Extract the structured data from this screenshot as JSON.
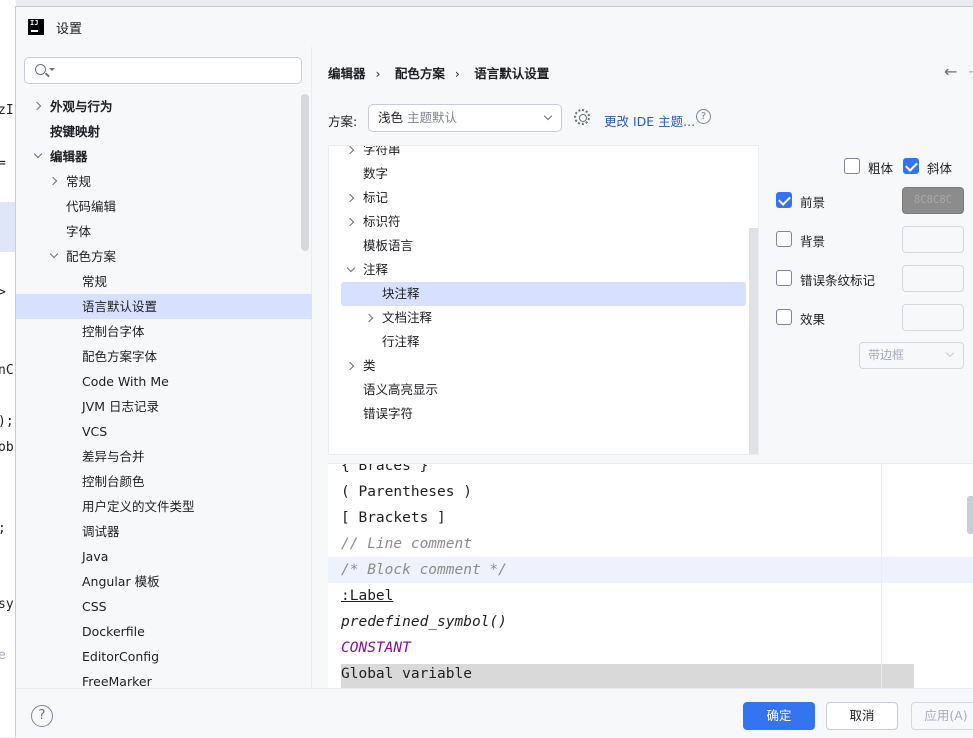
{
  "window": {
    "title": "设置"
  },
  "background_editor": {
    "fragments": [
      "zI",
      "=",
      ">",
      "nC",
      ");",
      "ob",
      ";",
      "sy",
      "e"
    ]
  },
  "search": {
    "placeholder": ""
  },
  "tree": [
    {
      "label": "外观与行为",
      "bold": true,
      "expand": "collapsed"
    },
    {
      "label": "按键映射",
      "bold": true,
      "expand": "none"
    },
    {
      "label": "编辑器",
      "bold": true,
      "expand": "expanded"
    },
    {
      "label": "常规",
      "bold": false,
      "expand": "collapsed"
    },
    {
      "label": "代码编辑",
      "bold": false,
      "expand": "none"
    },
    {
      "label": "字体",
      "bold": false,
      "expand": "none"
    },
    {
      "label": "配色方案",
      "bold": false,
      "expand": "expanded"
    },
    {
      "label": "常规",
      "bold": false,
      "expand": "none"
    },
    {
      "label": "语言默认设置",
      "bold": false,
      "expand": "none",
      "selected": true
    },
    {
      "label": "控制台字体",
      "bold": false,
      "expand": "none"
    },
    {
      "label": "配色方案字体",
      "bold": false,
      "expand": "none"
    },
    {
      "label": "Code With Me",
      "bold": false,
      "expand": "none"
    },
    {
      "label": "JVM 日志记录",
      "bold": false,
      "expand": "none"
    },
    {
      "label": "VCS",
      "bold": false,
      "expand": "none"
    },
    {
      "label": "差异与合并",
      "bold": false,
      "expand": "none"
    },
    {
      "label": "控制台颜色",
      "bold": false,
      "expand": "none"
    },
    {
      "label": "用户定义的文件类型",
      "bold": false,
      "expand": "none"
    },
    {
      "label": "调试器",
      "bold": false,
      "expand": "none"
    },
    {
      "label": "Java",
      "bold": false,
      "expand": "none"
    },
    {
      "label": "Angular 模板",
      "bold": false,
      "expand": "none"
    },
    {
      "label": "CSS",
      "bold": false,
      "expand": "none"
    },
    {
      "label": "Dockerfile",
      "bold": false,
      "expand": "none"
    },
    {
      "label": "EditorConfig",
      "bold": false,
      "expand": "none"
    },
    {
      "label": "FreeMarker",
      "bold": false,
      "expand": "none"
    }
  ],
  "breadcrumb": [
    "编辑器",
    "配色方案",
    "语言默认设置"
  ],
  "nav": {
    "back": "←",
    "forward": "→"
  },
  "scheme": {
    "label": "方案:",
    "value": "浅色",
    "hint": "主题默认",
    "link": "更改 IDE 主题...",
    "help": "?"
  },
  "attributes": [
    {
      "label": "字符串",
      "expand": "collapsed"
    },
    {
      "label": "数字",
      "expand": "none"
    },
    {
      "label": "标记",
      "expand": "collapsed"
    },
    {
      "label": "标识符",
      "expand": "collapsed"
    },
    {
      "label": "模板语言",
      "expand": "none"
    },
    {
      "label": "注释",
      "expand": "expanded"
    },
    {
      "label": "块注释",
      "expand": "none",
      "child": true,
      "selected": true
    },
    {
      "label": "文档注释",
      "expand": "collapsed",
      "child": true
    },
    {
      "label": "行注释",
      "expand": "none",
      "child": true
    },
    {
      "label": "类",
      "expand": "collapsed"
    },
    {
      "label": "语义高亮显示",
      "expand": "none"
    },
    {
      "label": "错误字符",
      "expand": "none"
    }
  ],
  "props": {
    "bold": {
      "label": "粗体",
      "checked": false
    },
    "italic": {
      "label": "斜体",
      "checked": true
    },
    "foreground": {
      "label": "前景",
      "checked": true,
      "color": "8C8C8C"
    },
    "background": {
      "label": "背景",
      "checked": false
    },
    "error_stripe": {
      "label": "错误条纹标记",
      "checked": false
    },
    "effects": {
      "label": "效果",
      "checked": false,
      "type": "带边框"
    }
  },
  "preview": [
    {
      "text": "{ Braces }",
      "style": "normal"
    },
    {
      "text": "( Parentheses )",
      "style": "normal"
    },
    {
      "text": "[ Brackets ]",
      "style": "normal"
    },
    {
      "text": "// Line comment",
      "style": "comment"
    },
    {
      "text": "/* Block comment */",
      "style": "comment"
    },
    {
      "text": ":Label",
      "style": "under"
    },
    {
      "text": "predefined_symbol()",
      "style": "italic"
    },
    {
      "text": "CONSTANT",
      "style": "purple"
    },
    {
      "text": "Global variable",
      "style": "normal"
    }
  ],
  "footer": {
    "help": "?",
    "ok": "确定",
    "cancel": "取消",
    "apply": "应用(A)"
  },
  "colors": {
    "accent": "#3574f0",
    "selection": "#d5e1ff",
    "link": "#2b59c3",
    "constant": "#871094"
  }
}
